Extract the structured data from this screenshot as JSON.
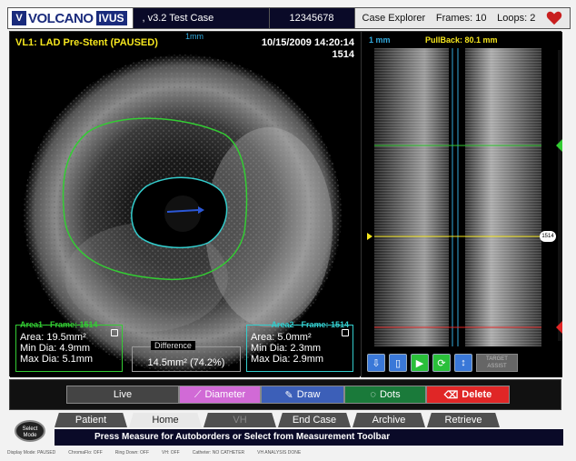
{
  "header": {
    "brand": "VOLCANO",
    "product": "IVUS",
    "case": ", v3.2 Test Case",
    "id": "12345678",
    "explorer": "Case Explorer",
    "frames": "Frames: 10",
    "loops": "Loops: 2"
  },
  "ivus": {
    "title": "VL1: LAD Pre-Stent (PAUSED)",
    "date": "10/15/2009 14:20:14",
    "frame": "1514",
    "scale": "1mm"
  },
  "area1": {
    "head": "Area1 - Frame: 1514",
    "area": "Area: 19.5mm²",
    "min": "Min Dia: 4.9mm",
    "max": "Max Dia: 5.1mm"
  },
  "difference": {
    "head": "Difference",
    "value": "14.5mm² (74.2%)"
  },
  "area2": {
    "head": "Area2 - Frame: 1514",
    "area": "Area: 5.0mm²",
    "min": "Min Dia: 2.3mm",
    "max": "Max Dia: 2.9mm"
  },
  "long_view": {
    "scale": "1 mm",
    "pullback": "PullBack: 80.1 mm",
    "frame_marker": "1514",
    "target_assist": "TARGET ASSIST"
  },
  "toolbar": {
    "live": "Live",
    "diameter": "Diameter",
    "draw": "Draw",
    "dots": "Dots",
    "delete": "Delete"
  },
  "nav": {
    "tabs": [
      "Patient",
      "Home",
      "VH",
      "End Case",
      "Archive",
      "Retrieve"
    ]
  },
  "select_mode": "Select Mode",
  "status_message": "Press Measure for Autoborders or Select from Measurement Toolbar",
  "footer": {
    "display_mode": "Display Mode: PAUSED",
    "chromaflo": "ChromaFlo: OFF",
    "ring_down": "Ring Down: OFF",
    "vh": "VH: OFF",
    "catheter": "Catheter: NO CATHETER",
    "vh_analysis": "VH ANALYSIS DONE"
  },
  "colors": {
    "area1": "#33cc33",
    "area2": "#33cccc",
    "accent_yellow": "#f5e61e",
    "delete": "#e02626"
  }
}
